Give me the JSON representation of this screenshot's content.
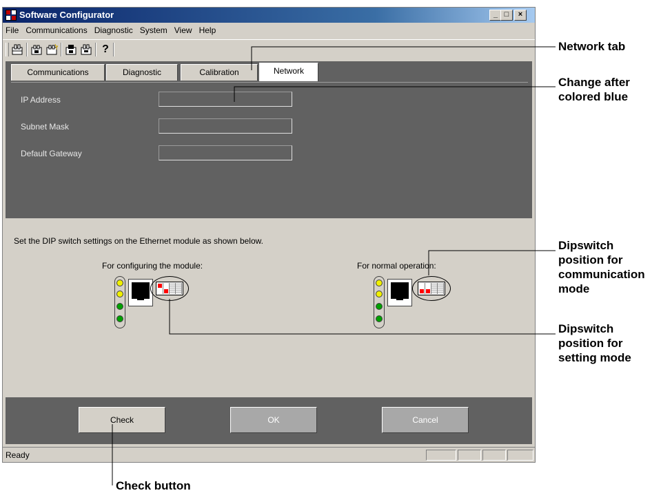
{
  "window": {
    "title": "Software Configurator",
    "controls": {
      "minimize": "_",
      "maximize": "□",
      "close": "×"
    }
  },
  "menu": [
    "File",
    "Communications",
    "Diagnostic",
    "System",
    "View",
    "Help"
  ],
  "toolbar": {
    "help_glyph": "?"
  },
  "tabs": [
    {
      "label": "Communications",
      "active": false
    },
    {
      "label": "Diagnostic",
      "active": false
    },
    {
      "label": "Calibration",
      "active": false
    },
    {
      "label": "Network",
      "active": true
    }
  ],
  "network": {
    "ip_label": "IP Address",
    "subnet_label": "Subnet Mask",
    "gateway_label": "Default Gateway",
    "ip_value": "",
    "subnet_value": "",
    "gateway_value": ""
  },
  "instructions": "Set the DIP switch settings on the Ethernet module as shown below.",
  "configuring_caption": "For configuring the module:",
  "normal_caption": "For normal operation:",
  "buttons": {
    "check": "Check",
    "ok": "OK",
    "cancel": "Cancel"
  },
  "status": {
    "text": "Ready"
  },
  "callouts": {
    "network_tab": "Network tab",
    "change_after_1": "Change after",
    "change_after_2": "colored blue",
    "dip_comm_1": "Dipswitch",
    "dip_comm_2": "position for",
    "dip_comm_3": "communication",
    "dip_comm_4": "mode",
    "dip_set_1": "Dipswitch",
    "dip_set_2": "position for",
    "dip_set_3": "setting mode",
    "check_button": "Check button"
  },
  "colors": {
    "led_yellow": "#f0f000",
    "led_green": "#00a000",
    "dip_red": "#ff0000"
  }
}
